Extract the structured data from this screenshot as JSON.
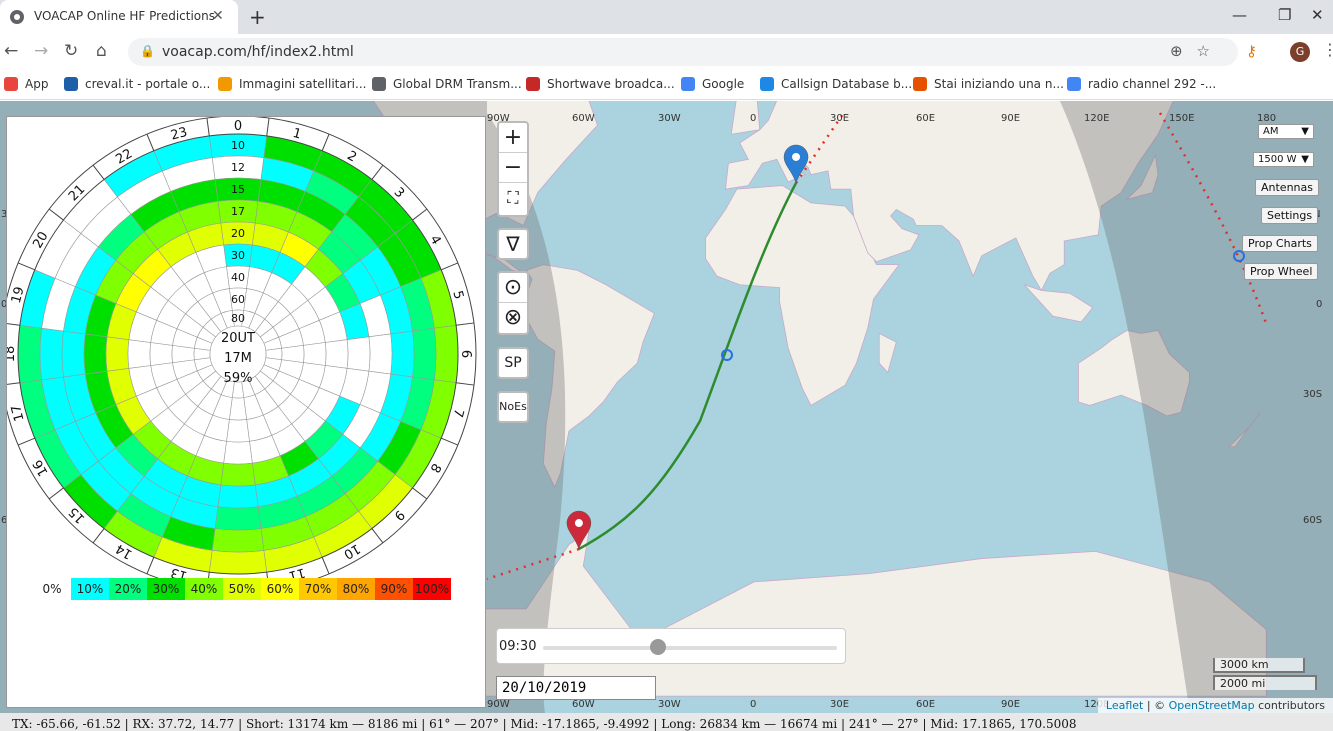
{
  "browser": {
    "tab_title": "VOACAP Online HF Predictions",
    "tab_close": "✕",
    "new_tab": "+",
    "window_min": "—",
    "window_max": "❐",
    "window_close": "✕",
    "url": "voacap.com/hf/index2.html",
    "avatar_letter": "G",
    "bookmarks": [
      {
        "label": "App",
        "color": "#e8453c"
      },
      {
        "label": "creval.it - portale o...",
        "color": "#1f5fa8"
      },
      {
        "label": "Immagini satellitari...",
        "color": "#f29900"
      },
      {
        "label": "Global DRM Transm...",
        "color": "#5f6368"
      },
      {
        "label": "Shortwave broadca...",
        "color": "#c62828"
      },
      {
        "label": "Google",
        "color": "#4285f4"
      },
      {
        "label": "Callsign Database b...",
        "color": "#1e88e5"
      },
      {
        "label": "Stai iniziando una n...",
        "color": "#e65100"
      },
      {
        "label": "radio channel 292 -...",
        "color": "#4285f4"
      }
    ]
  },
  "wheel": {
    "center_time": "20UT",
    "center_band": "17M",
    "center_pct": "59%",
    "hours": [
      "0",
      "1",
      "2",
      "3",
      "4",
      "5",
      "6",
      "7",
      "8",
      "9",
      "10",
      "11",
      "12",
      "13",
      "14",
      "15",
      "16",
      "17",
      "18",
      "19",
      "20",
      "21",
      "22",
      "23"
    ],
    "rings": [
      "10",
      "12",
      "15",
      "17",
      "20",
      "30",
      "40",
      "60",
      "80"
    ],
    "grid": [
      [
        10,
        30,
        30,
        30,
        30,
        40,
        40,
        40,
        40,
        50,
        50,
        50,
        50,
        50,
        40,
        30,
        20,
        20,
        20,
        10,
        0,
        0,
        10,
        10
      ],
      [
        0,
        10,
        20,
        30,
        30,
        20,
        20,
        20,
        30,
        40,
        40,
        40,
        40,
        30,
        20,
        10,
        10,
        10,
        10,
        0,
        0,
        0,
        0,
        0
      ],
      [
        30,
        30,
        30,
        20,
        10,
        10,
        10,
        10,
        10,
        20,
        20,
        20,
        20,
        10,
        10,
        10,
        10,
        10,
        10,
        10,
        10,
        20,
        30,
        30
      ],
      [
        40,
        40,
        40,
        20,
        10,
        0,
        0,
        0,
        0,
        10,
        10,
        10,
        10,
        10,
        10,
        20,
        30,
        30,
        30,
        30,
        40,
        40,
        40,
        40
      ],
      [
        50,
        50,
        60,
        40,
        20,
        10,
        0,
        0,
        10,
        20,
        30,
        40,
        40,
        40,
        40,
        40,
        50,
        50,
        50,
        50,
        60,
        60,
        50,
        50
      ],
      [
        10,
        10,
        10,
        0,
        0,
        0,
        0,
        0,
        0,
        0,
        0,
        0,
        0,
        0,
        0,
        0,
        0,
        0,
        0,
        0,
        0,
        0,
        0,
        0
      ],
      [
        0,
        0,
        0,
        0,
        0,
        0,
        0,
        0,
        0,
        0,
        0,
        0,
        0,
        0,
        0,
        0,
        0,
        0,
        0,
        0,
        0,
        0,
        0,
        0
      ],
      [
        0,
        0,
        0,
        0,
        0,
        0,
        0,
        0,
        0,
        0,
        0,
        0,
        0,
        0,
        0,
        0,
        0,
        0,
        0,
        0,
        0,
        0,
        0,
        0
      ],
      [
        0,
        0,
        0,
        0,
        0,
        0,
        0,
        0,
        0,
        0,
        0,
        0,
        0,
        0,
        0,
        0,
        0,
        0,
        0,
        0,
        0,
        0,
        0,
        0
      ]
    ],
    "legend": [
      {
        "label": "0%",
        "color": "#ffffff"
      },
      {
        "label": "10%",
        "color": "#00ffff"
      },
      {
        "label": "20%",
        "color": "#00ff7f"
      },
      {
        "label": "30%",
        "color": "#00e000"
      },
      {
        "label": "40%",
        "color": "#80ff00"
      },
      {
        "label": "50%",
        "color": "#e0ff00"
      },
      {
        "label": "60%",
        "color": "#ffff00"
      },
      {
        "label": "70%",
        "color": "#ffc800"
      },
      {
        "label": "80%",
        "color": "#ffa500"
      },
      {
        "label": "90%",
        "color": "#ff5000"
      },
      {
        "label": "100%",
        "color": "#ff0000"
      }
    ]
  },
  "map": {
    "zoom_in": "+",
    "zoom_out": "−",
    "fullscreen": "⛶",
    "btn_nabla": "∇",
    "btn_dot": "⊙",
    "btn_cross": "⊗",
    "btn_sp": "SP",
    "btn_noes": "NoEs",
    "mode_select": "AM",
    "power_select": "1500 W",
    "btn_antennas": "Antennas",
    "btn_settings": "Settings",
    "btn_prop_charts": "Prop Charts",
    "btn_prop_wheel": "Prop Wheel",
    "time": "09:30",
    "time_fraction": 0.39,
    "date": "20/10/2019",
    "scale_km": "3000 km",
    "scale_mi": "2000 mi",
    "attrib_leaflet": "Leaflet",
    "attrib_sep": " | © ",
    "attrib_osm": "OpenStreetMap",
    "attrib_tail": " contributors",
    "top_axis": [
      "90W",
      "60W",
      "30W",
      "0",
      "30E",
      "60E",
      "90E",
      "120E",
      "150E",
      "180"
    ],
    "bottom_axis": [
      "90W",
      "60W",
      "30W",
      "0",
      "30E",
      "60E",
      "90E",
      "120E"
    ],
    "right_axis": [
      "N",
      "0",
      "30S",
      "60S"
    ],
    "left_axis": [
      "3",
      "0",
      "6"
    ],
    "tx": {
      "lat": -65.66,
      "lon": -61.52
    },
    "rx": {
      "lat": 37.72,
      "lon": 14.77
    },
    "colors": {
      "water": "#aad3df",
      "land": "#f2efe9",
      "path": "#2e8b2e",
      "tx_pin": "#cc2a3a",
      "rx_pin": "#2a7fd4",
      "night": "rgba(110,110,110,0.35)"
    }
  },
  "status": {
    "text": "TX: -65.66, -61.52  |  RX: 37.72, 14.77  |  Short: 13174 km — 8186 mi  |  61° — 207°  |  Mid: -17.1865, -9.4992  |  Long: 26834 km — 16674 mi  |  241° — 27°  |  Mid: 17.1865, 170.5008"
  }
}
